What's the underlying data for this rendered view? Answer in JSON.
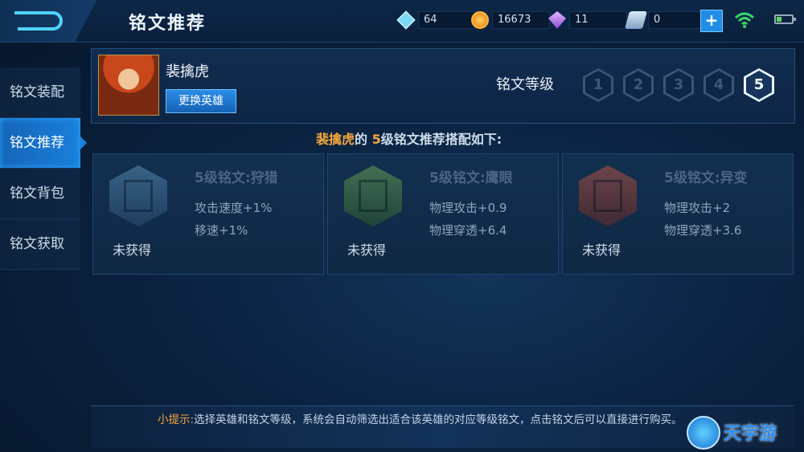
{
  "header": {
    "title": "铭文推荐",
    "currencies": [
      {
        "icon": "diamond-icon",
        "value": "64"
      },
      {
        "icon": "gold-coin-icon",
        "value": "16673"
      },
      {
        "icon": "purple-gem-icon",
        "value": "11"
      },
      {
        "icon": "crystal-icon",
        "value": "0"
      }
    ],
    "plus_label": "+"
  },
  "sidebar": {
    "items": [
      {
        "label": "铭文装配"
      },
      {
        "label": "铭文推荐"
      },
      {
        "label": "铭文背包"
      },
      {
        "label": "铭文获取"
      }
    ],
    "active_index": 1
  },
  "hero": {
    "name": "裴擒虎",
    "change_button": "更换英雄"
  },
  "levels": {
    "label": "铭文等级",
    "options": [
      "1",
      "2",
      "3",
      "4",
      "5"
    ],
    "selected": "5"
  },
  "recommend": {
    "hero": "裴擒虎",
    "mid": "的 ",
    "level": "5",
    "suffix": "级铭文推荐搭配如下:"
  },
  "runes": [
    {
      "name": "5级铭文:狩猎",
      "color": "blue",
      "stats": [
        "攻击速度+1%",
        "移速+1%"
      ],
      "status": "未获得"
    },
    {
      "name": "5级铭文:鹰眼",
      "color": "green",
      "stats": [
        "物理攻击+0.9",
        "物理穿透+6.4"
      ],
      "status": "未获得"
    },
    {
      "name": "5级铭文:异变",
      "color": "red",
      "stats": [
        "物理攻击+2",
        "物理穿透+3.6"
      ],
      "status": "未获得"
    }
  ],
  "tip": {
    "label": "小提示:",
    "text": "选择英雄和铭文等级，系统会自动筛选出适合该英雄的对应等级铭文，点击铭文后可以直接进行购买。"
  },
  "watermark": {
    "text": "天宇游"
  }
}
